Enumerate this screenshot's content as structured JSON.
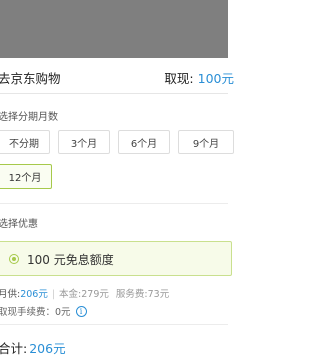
{
  "header": {
    "merchant": "去京东购物",
    "withdraw_label": "取现:",
    "withdraw_amount": "100元"
  },
  "installments": {
    "title": "选择分期月数",
    "options": [
      "不分期",
      "3个月",
      "6个月",
      "9个月",
      "12个月"
    ],
    "selected": "12个月"
  },
  "coupons": {
    "title": "选择优惠",
    "item": "100 元免息额度"
  },
  "summary": {
    "monthly_label": "月供:",
    "monthly_value": "206元",
    "principal": "本金:279元",
    "service_fee": "服务费:73元",
    "fee_text": "取现手续费：0元"
  },
  "total": {
    "label": "合计:",
    "value": "206元"
  },
  "colors": {
    "accent_blue": "#2a8fd6",
    "selected_green": "#a6c94b",
    "overlay": "#7f7f7f"
  }
}
